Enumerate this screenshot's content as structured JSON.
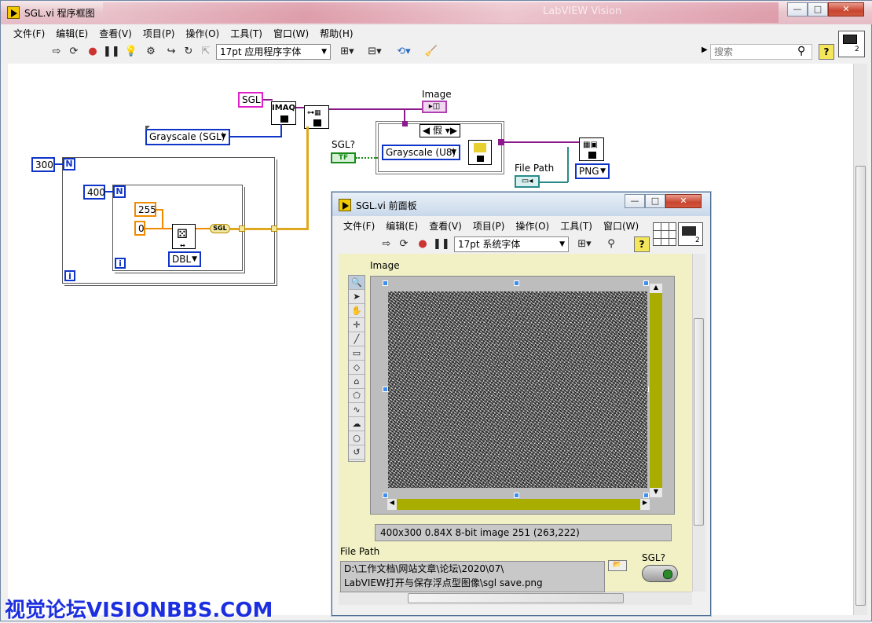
{
  "main_window": {
    "title": "SGL.vi 程序框图",
    "blurred_title": "LabVIEW Vision",
    "menu": [
      "文件(F)",
      "编辑(E)",
      "查看(V)",
      "项目(P)",
      "操作(O)",
      "工具(T)",
      "窗口(W)",
      "帮助(H)"
    ],
    "font_select": "17pt 应用程序字体",
    "search_placeholder": "搜索"
  },
  "diagram": {
    "sgl_const": "SGL",
    "image_type_enum": "Grayscale (SGL)",
    "imaq_label": "IMAQ",
    "image_indicator_label": "Image",
    "case_selector": "假",
    "grayscale_u8_enum": "Grayscale (U8)",
    "sgl_bool_label": "SGL?",
    "bool_terminal": "TF",
    "file_path_label": "File Path",
    "png_enum": "PNG",
    "outer_n": "300",
    "inner_n": "400",
    "n_term": "N",
    "i_term": "i",
    "const_255": "255",
    "const_0": "0",
    "dbl_enum": "DBL",
    "sgl_conv": "SGL"
  },
  "front_panel": {
    "title": "SGL.vi 前面板",
    "menu": [
      "文件(F)",
      "编辑(E)",
      "查看(V)",
      "项目(P)",
      "操作(O)",
      "工具(T)",
      "窗口(W)"
    ],
    "font_select": "17pt 系统字体",
    "image_label": "Image",
    "status": "400x300 0.84X 8-bit image 251     (263,222)",
    "file_path_label": "File Path",
    "file_path_line1": "D:\\工作文档\\网站文章\\论坛\\2020\\07\\",
    "file_path_line2": "LabVIEW打开与保存浮点型图像\\sgl save.png",
    "sgl_toggle_label": "SGL?"
  },
  "watermark": "视觉论坛VISIONBBS.COM",
  "colors": {
    "int_wire": "#1034c8",
    "dbl_wire": "#f08a00",
    "image_wire": "#8c1a8c",
    "bool_wire": "#1a8a1a",
    "panel_bg": "#f1f1c5"
  }
}
